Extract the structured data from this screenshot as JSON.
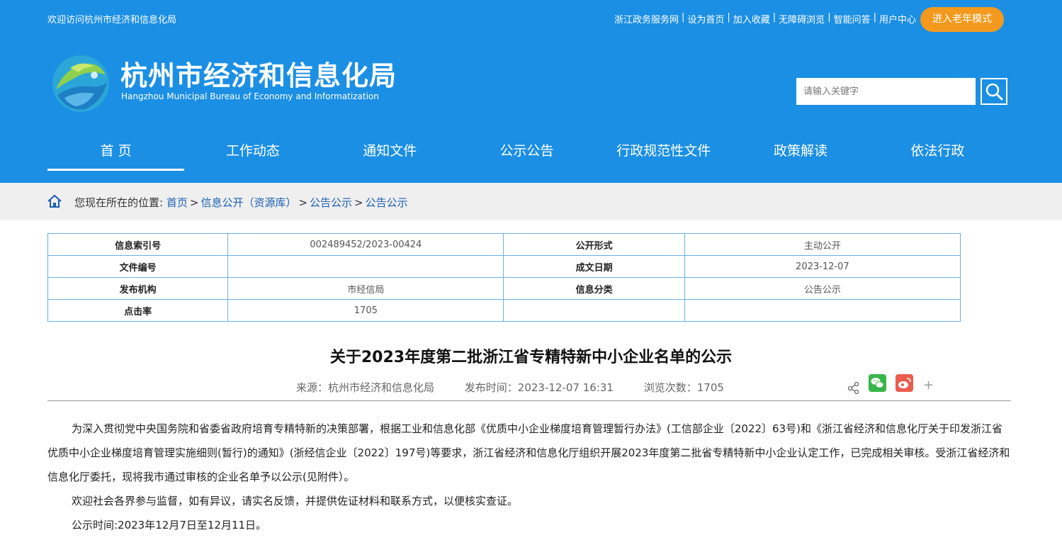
{
  "header": {
    "welcome": "欢迎访问杭州市经济和信息化局",
    "top_links": [
      "浙江政务服务网",
      "设为首页",
      "加入收藏",
      "无障碍浏览",
      "智能问答",
      "用户中心"
    ],
    "elder_mode": "进入老年模式",
    "site_title": "杭州市经济和信息化局",
    "site_subtitle": "Hangzhou Municipal Bureau of Economy and Informatization",
    "search_placeholder": "请输入关键字",
    "brand_color": "#1b8fe4",
    "accent_color": "#f39a1e"
  },
  "nav": [
    "首 页",
    "工作动态",
    "通知文件",
    "公示公告",
    "行政规范性文件",
    "政策解读",
    "依法行政"
  ],
  "breadcrumb": {
    "prefix": "您现在所在的位置:",
    "items": [
      "首页",
      "信息公开（资源库）",
      "公告公示",
      "公告公示"
    ]
  },
  "meta_table": {
    "rows": [
      [
        "信息索引号",
        "002489452/2023-00424",
        "公开形式",
        "主动公开"
      ],
      [
        "文件编号",
        "",
        "成文日期",
        "2023-12-07"
      ],
      [
        "发布机构",
        "市经信局",
        "信息分类",
        "公告公示"
      ],
      [
        "点击率",
        "1705",
        "",
        ""
      ]
    ]
  },
  "article": {
    "title": "关于2023年度第二批浙江省专精特新中小企业名单的公示",
    "source": "来源：杭州市经济和信息化局",
    "publish_time": "发布时间：2023-12-07 16:31",
    "views": "浏览次数：1705",
    "paragraphs": [
      "为深入贯彻党中央国务院和省委省政府培育专精特新的决策部署，根据工业和信息化部《优质中小企业梯度培育管理暂行办法》(工信部企业〔2022〕63号)和《浙江省经济和信息化厅关于印发浙江省优质中小企业梯度培育管理实施细则(暂行)的通知》(浙经信企业〔2022〕197号)等要求，浙江省经济和信息化厅组织开展2023年度第二批省专精特新中小企业认定工作，已完成相关审核。受浙江省经济和信息化厅委托，现将我市通过审核的企业名单予以公示(见附件）。",
      "欢迎社会各界参与监督，如有异议，请实名反馈，并提供佐证材料和联系方式，以便核实查证。",
      "公示时间:2023年12月7日至12月11日。"
    ]
  },
  "icons": [
    "home-icon",
    "search-icon",
    "share-icon",
    "wechat-icon",
    "weibo-icon",
    "plus-icon",
    "logo-icon"
  ]
}
